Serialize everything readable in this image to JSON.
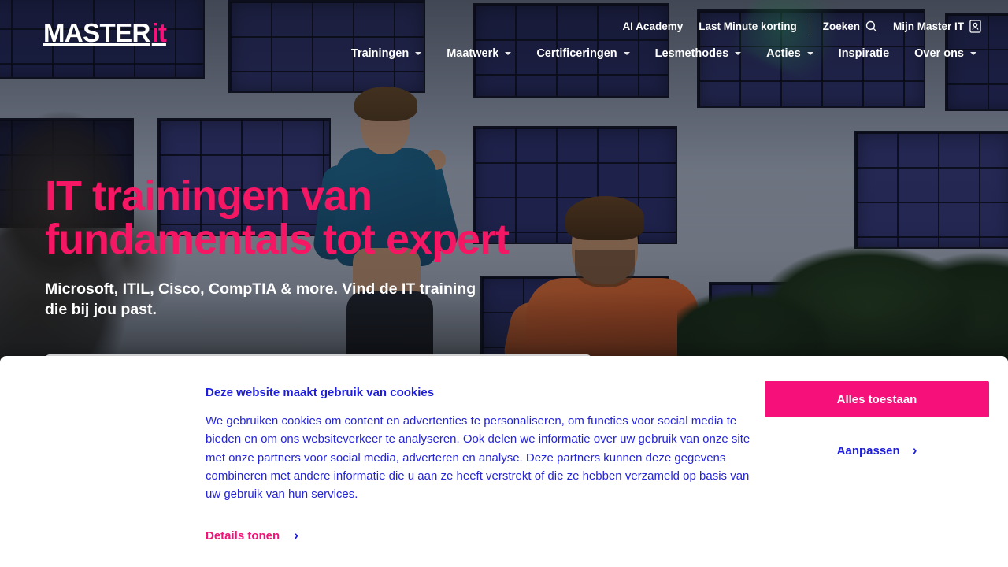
{
  "brand": {
    "logo_main": "MASTER",
    "logo_accent": "it",
    "accent_color": "#f51279"
  },
  "header": {
    "topbar": [
      {
        "label": "AI Academy",
        "icon": null
      },
      {
        "label": "Last Minute korting",
        "icon": null
      },
      {
        "label": "Zoeken",
        "icon": "search-icon"
      },
      {
        "label": "Mijn Master IT",
        "icon": "user-account-icon"
      }
    ],
    "nav": [
      {
        "label": "Trainingen",
        "has_dropdown": true
      },
      {
        "label": "Maatwerk",
        "has_dropdown": true
      },
      {
        "label": "Certificeringen",
        "has_dropdown": true
      },
      {
        "label": "Lesmethodes",
        "has_dropdown": true
      },
      {
        "label": "Acties",
        "has_dropdown": true
      },
      {
        "label": "Inspiratie",
        "has_dropdown": false
      },
      {
        "label": "Over ons",
        "has_dropdown": true
      }
    ]
  },
  "hero": {
    "title_line1": "IT trainingen van",
    "title_line2": "fundamentals tot expert",
    "subtitle_line1": "Microsoft, ITIL, Cisco, CompTIA & more. Vind de IT training",
    "subtitle_line2": "die bij jou past.",
    "title_color": "#f51764"
  },
  "cookie_banner": {
    "heading": "Deze website maakt gebruik van cookies",
    "body": "We gebruiken cookies om content en advertenties te personaliseren, om functies voor social media te bieden en om ons websiteverkeer te analyseren. Ook delen we informatie over uw gebruik van onze site met onze partners voor social media, adverteren en analyse. Deze partners kunnen deze gegevens combineren met andere informatie die u aan ze heeft verstrekt of die ze hebben verzameld op basis van uw gebruik van hun services.",
    "details_link": "Details tonen",
    "details_chevron": "›",
    "accept_label": "Alles toestaan",
    "customize_label": "Aanpassen",
    "customize_chevron": "›",
    "accept_color": "#f5107a",
    "text_color": "#2525d8"
  }
}
